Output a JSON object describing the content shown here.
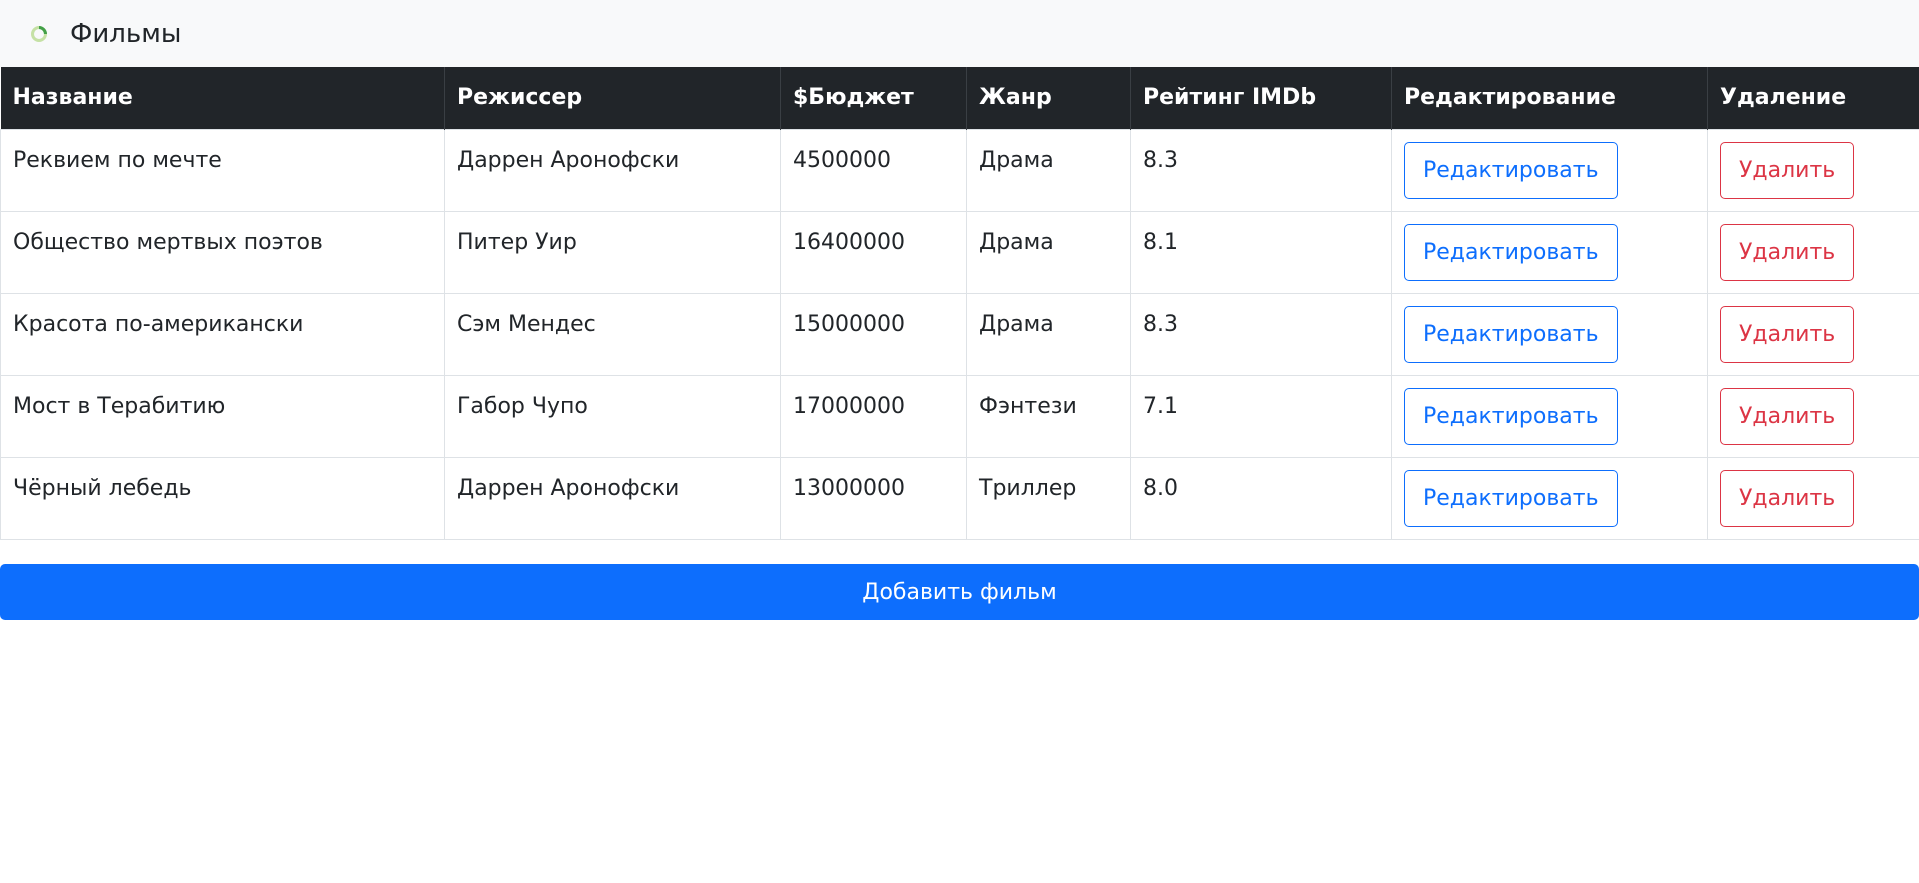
{
  "navbar": {
    "logo_icon": "spinner-logo-icon",
    "title": "Фильмы"
  },
  "table": {
    "headers": [
      "Название",
      "Режиссер",
      "$Бюджет",
      "Жанр",
      "Рейтинг IMDb",
      "Редактирование",
      "Удаление"
    ],
    "rows": [
      {
        "title": "Реквием по мечте",
        "director": "Даррен Аронофски",
        "budget": "4500000",
        "genre": "Драма",
        "rating": "8.3",
        "edit_label": "Редактировать",
        "delete_label": "Удалить"
      },
      {
        "title": "Общество мертвых поэтов",
        "director": "Питер Уир",
        "budget": "16400000",
        "genre": "Драма",
        "rating": "8.1",
        "edit_label": "Редактировать",
        "delete_label": "Удалить"
      },
      {
        "title": "Красота по-американски",
        "director": "Сэм Мендес",
        "budget": "15000000",
        "genre": "Драма",
        "rating": "8.3",
        "edit_label": "Редактировать",
        "delete_label": "Удалить"
      },
      {
        "title": "Мост в Терабитию",
        "director": "Габор Чупо",
        "budget": "17000000",
        "genre": "Фэнтези",
        "rating": "7.1",
        "edit_label": "Редактировать",
        "delete_label": "Удалить"
      },
      {
        "title": "Чёрный лебедь",
        "director": "Даррен Аронофски",
        "budget": "13000000",
        "genre": "Триллер",
        "rating": "8.0",
        "edit_label": "Редактировать",
        "delete_label": "Удалить"
      }
    ]
  },
  "actions": {
    "add_label": "Добавить фильм"
  },
  "colors": {
    "header_bg": "#212529",
    "primary": "#0d6efd",
    "danger": "#dc3545",
    "navbar_bg": "#f8f9fa"
  }
}
